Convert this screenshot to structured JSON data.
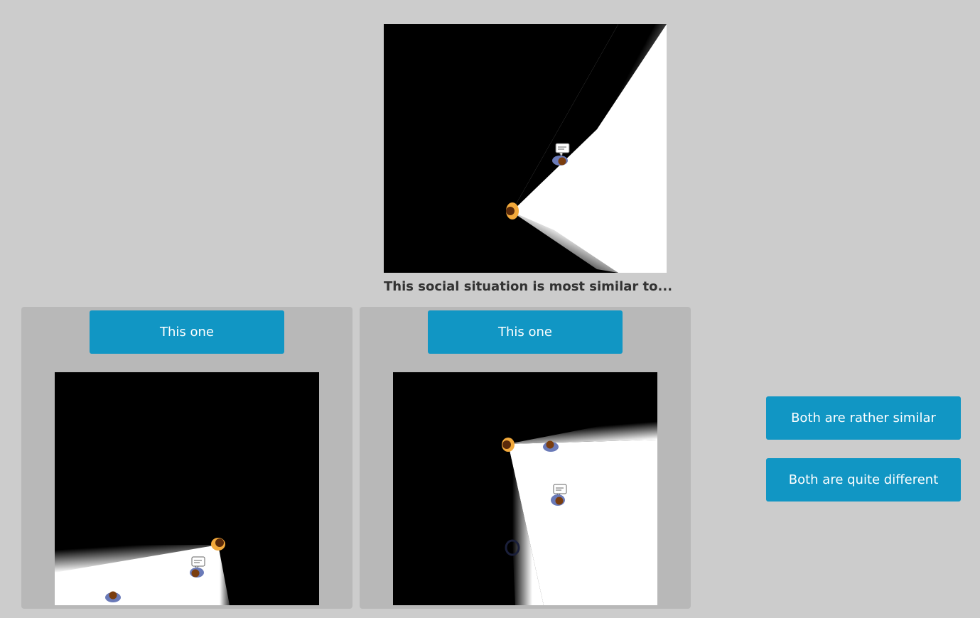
{
  "prompt_text": "This social situation is most similar to...",
  "option_left": {
    "button_label": "This one"
  },
  "option_right": {
    "button_label": "This one"
  },
  "side_buttons": {
    "similar_label": "Both are rather similar",
    "different_label": "Both are quite different"
  },
  "colors": {
    "background": "#cccccc",
    "panel": "#b8b8b8",
    "button": "#1196c4",
    "scene_dark": "#000000",
    "scene_light": "#ffffff",
    "observer": "#f2a93b",
    "other_person": "#6a7ab8",
    "head": "#7a3d0e"
  },
  "icons": [
    "observer-person-icon",
    "person-icon",
    "speech-bubble-icon"
  ]
}
